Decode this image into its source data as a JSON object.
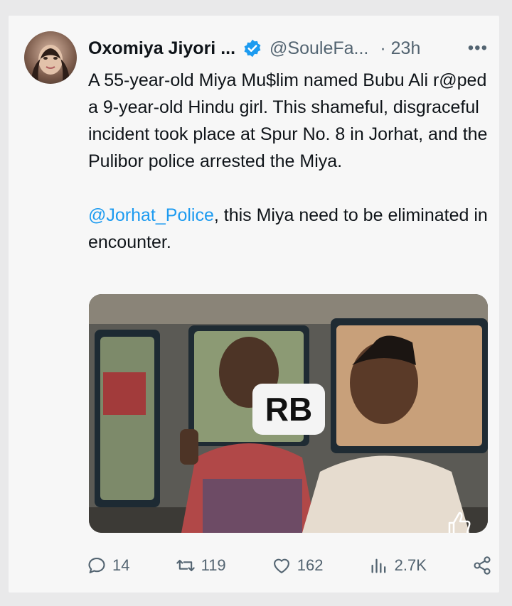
{
  "tweet": {
    "author_name": "Oxomiya Jiyori ...",
    "handle": "@SouleFa...",
    "time": "· 23h",
    "more": "•••",
    "text_part1": "A 55-year-old Miya Mu$lim named Bubu Ali r@ped a 9-year-old Hindu girl. This shameful, disgraceful incident took place at Spur No. 8 in Jorhat, and the Pulibor police arrested the Miya.\n\n",
    "mention": "@Jorhat_Police",
    "text_part2": ", this Miya need to be eliminated in encounter.",
    "media_badge": "RB"
  },
  "actions": {
    "replies": "14",
    "retweets": "119",
    "likes": "162",
    "views": "2.7K"
  },
  "icons": {
    "verified": "verified-badge-icon",
    "reply": "reply-icon",
    "retweet": "retweet-icon",
    "like": "heart-icon",
    "views": "views-icon",
    "share": "share-icon"
  },
  "colors": {
    "accent": "#1d9bf0",
    "muted": "#536471",
    "text": "#0f1419"
  }
}
